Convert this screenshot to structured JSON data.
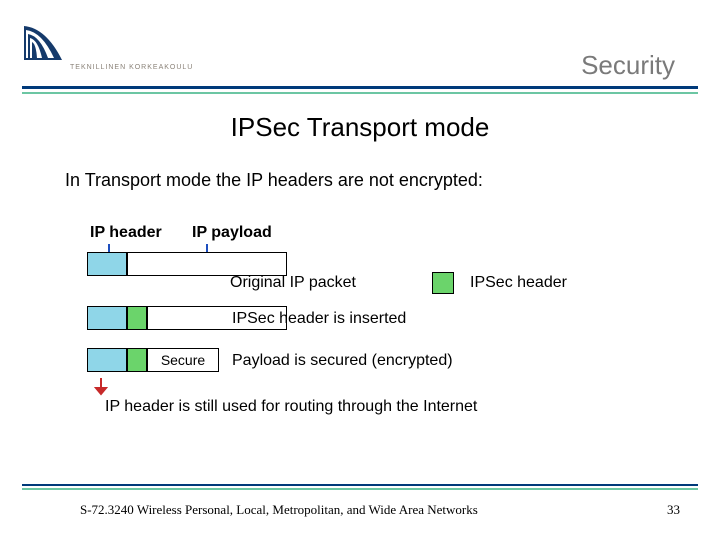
{
  "header": {
    "section_title": "Security",
    "logo_caption": "TEKNILLINEN  KORKEAKOULU"
  },
  "main": {
    "title": "IPSec Transport mode",
    "lead": "In Transport mode the IP headers are not encrypted:",
    "labels": {
      "ip_header": "IP header",
      "ip_payload": "IP payload",
      "secure": "Secure"
    },
    "captions": {
      "row1": "Original IP packet",
      "row2": "IPSec header is inserted",
      "row3": "Payload is secured (encrypted)"
    },
    "legend": {
      "ipsec_header": "IPSec header"
    },
    "bottom_note": "IP header is still used for routing through the Internet",
    "icons": {
      "arrow1": "arrow-down-blue",
      "arrow2": "arrow-down-blue",
      "arrow3": "arrow-down-red"
    }
  },
  "colors": {
    "ip_header": "#8fd6e8",
    "ipsec_header": "#6bd46b",
    "payload": "#ffffff",
    "rule_primary": "#003a7a",
    "rule_accent": "#6cc6a3"
  },
  "footer": {
    "left": "S-72.3240 Wireless Personal, Local, Metropolitan, and Wide Area Networks",
    "page": "33"
  }
}
